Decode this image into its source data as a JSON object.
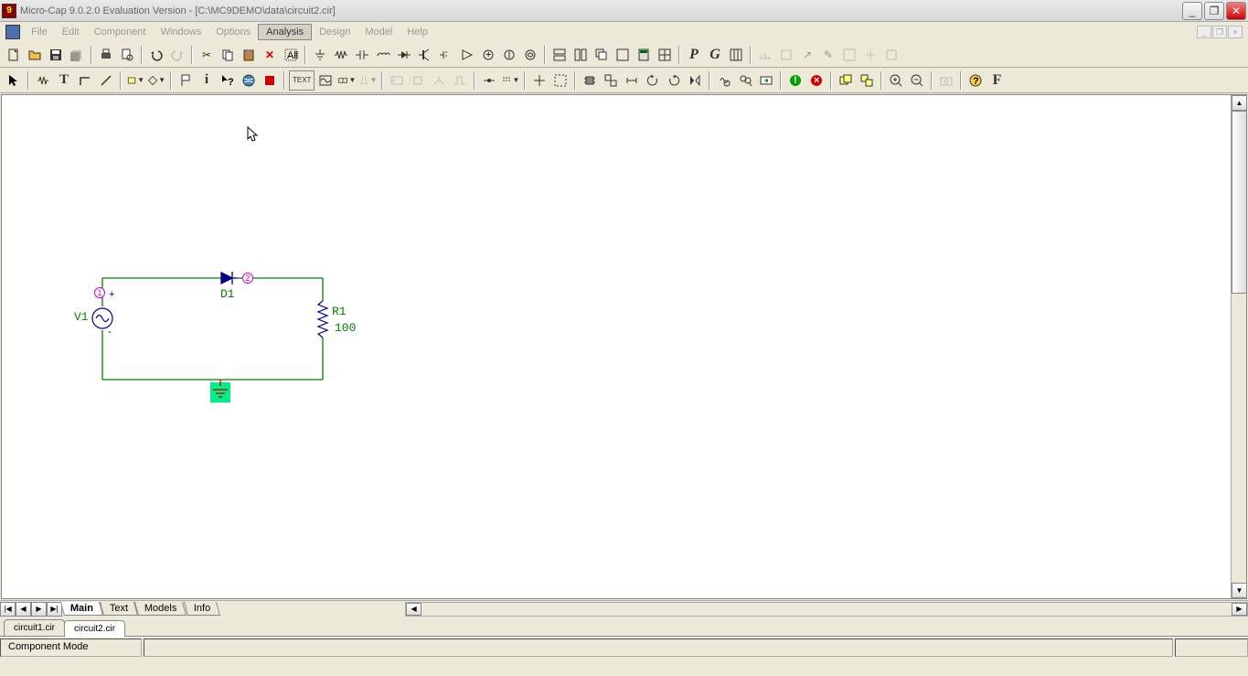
{
  "title": "Micro-Cap 9.0.2.0 Evaluation Version - [C:\\MC9DEMO\\data\\circuit2.cir]",
  "menus": {
    "file": "File",
    "edit": "Edit",
    "component": "Component",
    "windows": "Windows",
    "options": "Options",
    "analysis": "Analysis",
    "design": "Design",
    "model": "Model",
    "help": "Help"
  },
  "circuit": {
    "v1": "V1",
    "d1": "D1",
    "r1_name": "R1",
    "r1_val": "100",
    "node1": "1",
    "node2": "2"
  },
  "bottom_tabs": {
    "main": "Main",
    "text": "Text",
    "models": "Models",
    "info": "Info"
  },
  "file_tabs": {
    "f1": "circuit1.cir",
    "f2": "circuit2.cir"
  },
  "status": {
    "mode": "Component Mode"
  },
  "letters": {
    "p": "P",
    "g": "G",
    "t": "T",
    "f": "F",
    "text": "TEXT",
    "abc": "ABC"
  }
}
